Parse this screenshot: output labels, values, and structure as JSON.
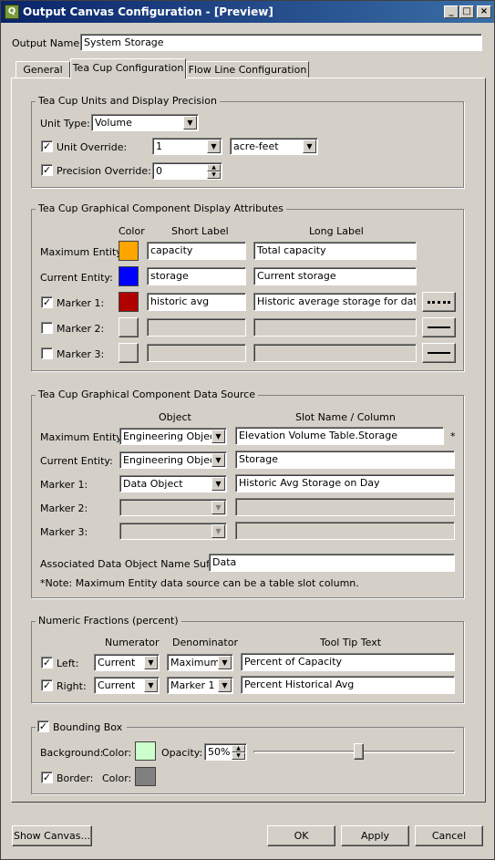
{
  "window": {
    "title": "Output Canvas Configuration - [Preview]",
    "icon_glyph": "Q",
    "minimize_glyph": "_",
    "maximize_glyph": "□",
    "close_glyph": "×"
  },
  "output_name": {
    "label": "Output Name:",
    "value": "System Storage"
  },
  "tabs": [
    {
      "label": "General",
      "active": false
    },
    {
      "label": "Tea Cup Configuration",
      "active": true
    },
    {
      "label": "Flow Line Configuration",
      "active": false
    }
  ],
  "units_group": {
    "title": "Tea Cup Units and Display Precision",
    "unit_type": {
      "label": "Unit Type:",
      "value": "Volume"
    },
    "unit_override": {
      "label": "Unit Override:",
      "checked": true,
      "scale": "1",
      "unit": "acre-feet"
    },
    "precision_override": {
      "label": "Precision Override:",
      "checked": true,
      "value": "0"
    }
  },
  "display_group": {
    "title": "Tea Cup Graphical Component Display Attributes",
    "headers": {
      "color": "Color",
      "short": "Short Label",
      "long": "Long Label"
    },
    "rows": [
      {
        "label": "Maximum Entity:",
        "has_check": false,
        "color": "#ffa500",
        "short": "capacity",
        "long": "Total capacity",
        "line": "none",
        "enabled": true
      },
      {
        "label": "Current Entity:",
        "has_check": false,
        "color": "#0000ff",
        "short": "storage",
        "long": "Current storage",
        "line": "none",
        "enabled": true
      },
      {
        "label": "Marker 1:",
        "has_check": true,
        "checked": true,
        "color": "#b00000",
        "short": "historic avg",
        "long": "Historic average storage for date",
        "line": "dotted",
        "enabled": true
      },
      {
        "label": "Marker 2:",
        "has_check": true,
        "checked": false,
        "color": "#d4d0c8",
        "short": "",
        "long": "",
        "line": "solid",
        "enabled": false
      },
      {
        "label": "Marker 3:",
        "has_check": true,
        "checked": false,
        "color": "#d4d0c8",
        "short": "",
        "long": "",
        "line": "solid",
        "enabled": false
      }
    ]
  },
  "source_group": {
    "title": "Tea Cup Graphical Component Data Source",
    "headers": {
      "object": "Object",
      "slot": "Slot Name / Column"
    },
    "rows": [
      {
        "label": "Maximum Entity:",
        "object": "Engineering Object",
        "slot": "Elevation Volume Table.Storage",
        "note": "*",
        "enabled": true
      },
      {
        "label": "Current Entity:",
        "object": "Engineering Object",
        "slot": "Storage",
        "note": "",
        "enabled": true
      },
      {
        "label": "Marker 1:",
        "object": "Data Object",
        "slot": "Historic Avg Storage on Day",
        "note": "",
        "enabled": true
      },
      {
        "label": "Marker 2:",
        "object": "",
        "slot": "",
        "note": "",
        "enabled": false
      },
      {
        "label": "Marker 3:",
        "object": "",
        "slot": "",
        "note": "",
        "enabled": false
      }
    ],
    "suffix": {
      "label": "Associated Data Object Name Suffix:",
      "value": "Data"
    },
    "footnote": "*Note: Maximum Entity data source can be a table slot column."
  },
  "fractions_group": {
    "title": "Numeric Fractions (percent)",
    "headers": {
      "numerator": "Numerator",
      "denominator": "Denominator",
      "tooltip": "Tool Tip Text"
    },
    "rows": [
      {
        "label": "Left:",
        "checked": true,
        "numerator": "Current",
        "denominator": "Maximum",
        "tooltip": "Percent of Capacity"
      },
      {
        "label": "Right:",
        "checked": true,
        "numerator": "Current",
        "denominator": "Marker 1",
        "tooltip": "Percent Historical Avg"
      }
    ]
  },
  "bbox_group": {
    "title": "Bounding Box",
    "checked": true,
    "background_label": "Background:",
    "color_label": "Color:",
    "background_color": "#ccffcc",
    "opacity_label": "Opacity:",
    "opacity_value": "50%",
    "opacity_fraction": 0.5,
    "border_label": "Border:",
    "border_checked": true,
    "border_color": "#808080"
  },
  "buttons": {
    "show_canvas": "Show Canvas...",
    "ok": "OK",
    "apply": "Apply",
    "cancel": "Cancel"
  },
  "glyphs": {
    "check": "✓",
    "down": "▼",
    "up_small": "▲",
    "down_small": "▼"
  }
}
